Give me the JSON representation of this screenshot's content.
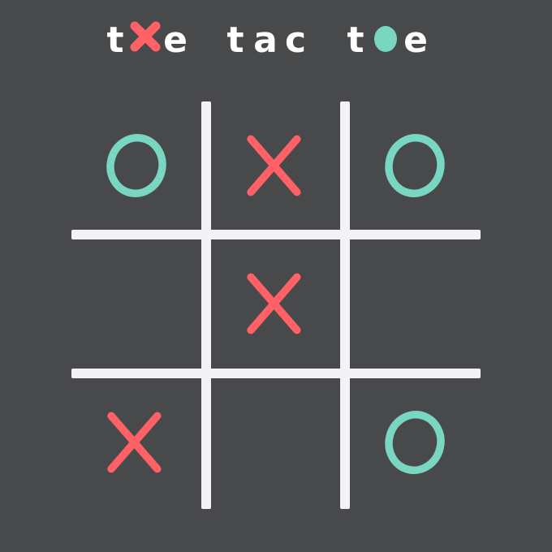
{
  "title": {
    "letters": [
      "t",
      "x",
      "e",
      " ",
      "t",
      "a",
      "c",
      " ",
      "t",
      "o",
      "e"
    ],
    "colors": {
      "normal": "#ffffff",
      "x": "#ff6166",
      "o": "#79d6c0"
    }
  },
  "board": {
    "cells": [
      "O",
      "X",
      "O",
      "",
      "X",
      "",
      "X",
      "",
      "O"
    ]
  },
  "colors": {
    "background": "#48494b",
    "grid": "#f4f2f8",
    "x_mark": "#ff6166",
    "o_mark": "#79d6c0"
  }
}
